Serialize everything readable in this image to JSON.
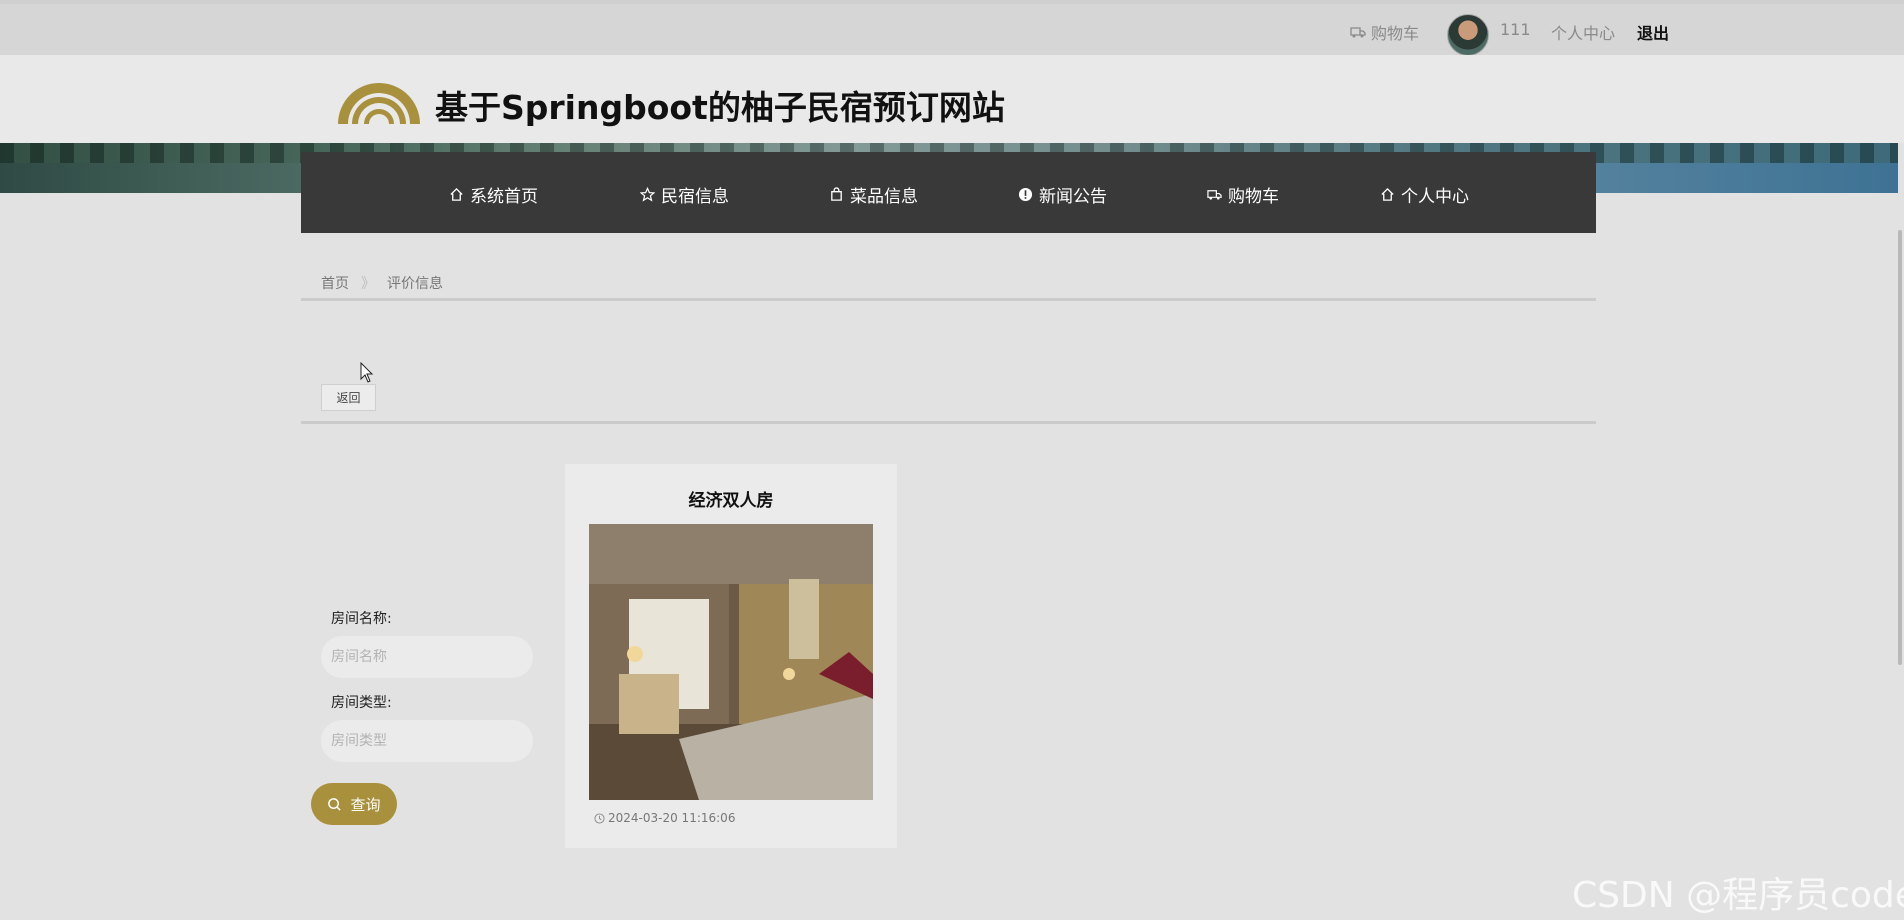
{
  "topbar": {
    "cart_label": "购物车",
    "username": "111",
    "profile_label": "个人中心",
    "logout_label": "退出"
  },
  "header": {
    "site_title": "基于Springboot的柚子民宿预订网站"
  },
  "nav": {
    "items": [
      {
        "label": "系统首页",
        "icon": "home-icon"
      },
      {
        "label": "民宿信息",
        "icon": "star-icon"
      },
      {
        "label": "菜品信息",
        "icon": "bag-icon"
      },
      {
        "label": "新闻公告",
        "icon": "alert-icon"
      },
      {
        "label": "购物车",
        "icon": "truck-icon"
      },
      {
        "label": "个人中心",
        "icon": "home-icon"
      }
    ]
  },
  "breadcrumb": {
    "home": "首页",
    "separator": "》",
    "current": "评价信息"
  },
  "back_button": "返回",
  "search": {
    "room_name_label": "房间名称:",
    "room_name_placeholder": "房间名称",
    "room_type_label": "房间类型:",
    "room_type_placeholder": "房间类型",
    "button_label": "查询"
  },
  "cards": [
    {
      "title": "经济双人房",
      "date": "2024-03-20 11:16:06"
    }
  ],
  "watermark": "CSDN @程序员code",
  "colors": {
    "accent": "#a8903d",
    "nav_bg": "#393939",
    "page_bg": "#e2e2e2"
  }
}
